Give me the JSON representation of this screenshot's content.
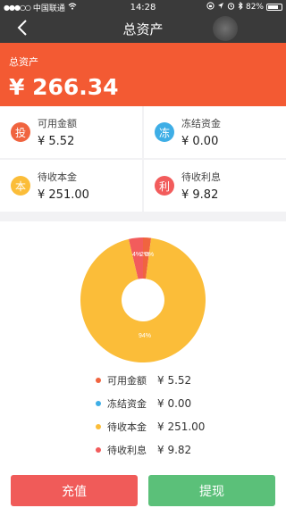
{
  "status_bar": {
    "carrier": "中国联通",
    "time": "14:28",
    "battery": "82%"
  },
  "nav": {
    "title": "总资产",
    "back_icon": "chevron-left-icon"
  },
  "hero": {
    "label": "总资产",
    "value": "¥ 266.34"
  },
  "summary": [
    {
      "badge": "投",
      "label": "可用金额",
      "value": "¥ 5.52",
      "color": "#f0643f"
    },
    {
      "badge": "冻",
      "label": "冻结资金",
      "value": "¥ 0.00",
      "color": "#3eaee6"
    },
    {
      "badge": "本",
      "label": "待收本金",
      "value": "¥ 251.00",
      "color": "#fbbd39"
    },
    {
      "badge": "利",
      "label": "待收利息",
      "value": "¥ 9.82",
      "color": "#f25c5c"
    }
  ],
  "chart_data": {
    "type": "pie",
    "categories": [
      "可用金额",
      "冻结资金",
      "待收本金",
      "待收利息"
    ],
    "values": [
      5.52,
      0.0,
      251.0,
      9.82
    ],
    "colors": [
      "#f0643f",
      "#3eaee6",
      "#fbbd39",
      "#f25c5c"
    ],
    "slice_labels": [
      "2%",
      "0%",
      "94%",
      "4%"
    ]
  },
  "legend": [
    {
      "label": "可用金额",
      "value": "¥ 5.52",
      "color": "#f0643f"
    },
    {
      "label": "冻结资金",
      "value": "¥ 0.00",
      "color": "#3eaee6"
    },
    {
      "label": "待收本金",
      "value": "¥ 251.00",
      "color": "#fbbd39"
    },
    {
      "label": "待收利息",
      "value": "¥ 9.82",
      "color": "#f25c5c"
    }
  ],
  "footer": {
    "recharge": "充值",
    "withdraw": "提现"
  }
}
